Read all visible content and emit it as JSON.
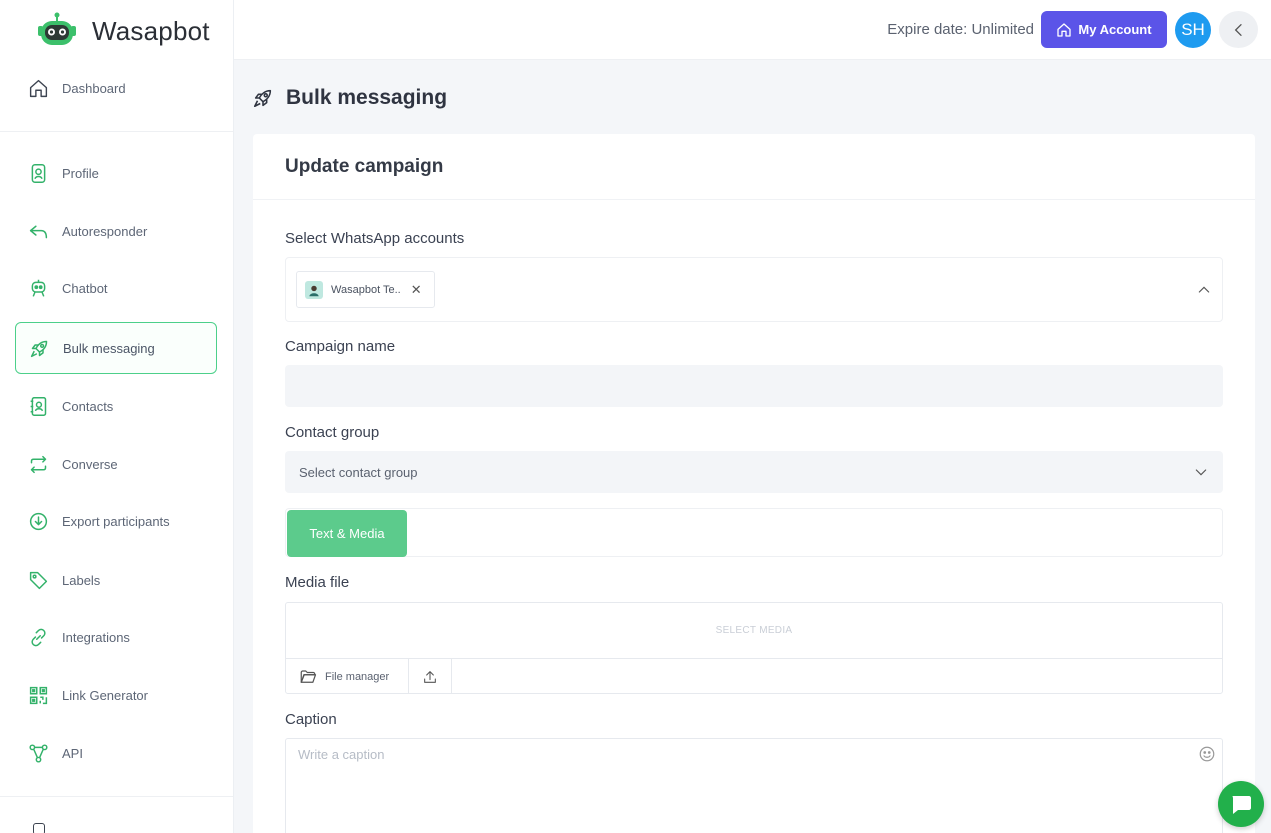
{
  "brand": {
    "name": "Wasapbot"
  },
  "topbar": {
    "expire": "Expire date: Unlimited",
    "account_label": "My Account",
    "avatar_initials": "SH"
  },
  "sidebar": {
    "items": [
      {
        "label": "Dashboard",
        "icon": "home-icon"
      },
      {
        "label": "Profile",
        "icon": "profile-icon"
      },
      {
        "label": "Autoresponder",
        "icon": "reply-icon"
      },
      {
        "label": "Chatbot",
        "icon": "robot-icon"
      },
      {
        "label": "Bulk messaging",
        "icon": "rocket-icon",
        "active": true
      },
      {
        "label": "Contacts",
        "icon": "contacts-icon"
      },
      {
        "label": "Converse",
        "icon": "exchange-icon"
      },
      {
        "label": "Export participants",
        "icon": "download-icon"
      },
      {
        "label": "Labels",
        "icon": "tag-icon"
      },
      {
        "label": "Integrations",
        "icon": "link-icon"
      },
      {
        "label": "Link Generator",
        "icon": "qr-icon"
      },
      {
        "label": "API",
        "icon": "api-icon"
      }
    ]
  },
  "page": {
    "title": "Bulk messaging",
    "card_title": "Update campaign"
  },
  "form": {
    "accounts_label": "Select WhatsApp accounts",
    "selected_account": "Wasapbot Te..",
    "campaign_name_label": "Campaign name",
    "campaign_name_value": "",
    "contact_group_label": "Contact group",
    "contact_group_placeholder": "Select contact group",
    "tab_label": "Text & Media",
    "media_label": "Media file",
    "select_media": "SELECT MEDIA",
    "file_manager": "File manager",
    "caption_label": "Caption",
    "caption_placeholder": "Write a caption"
  },
  "colors": {
    "accent_green": "#4cd08a",
    "tab_green": "#5ccb8c",
    "account_button": "#5b54e8",
    "avatar_blue": "#1e9bf0",
    "chat_fab": "#22b04b"
  }
}
